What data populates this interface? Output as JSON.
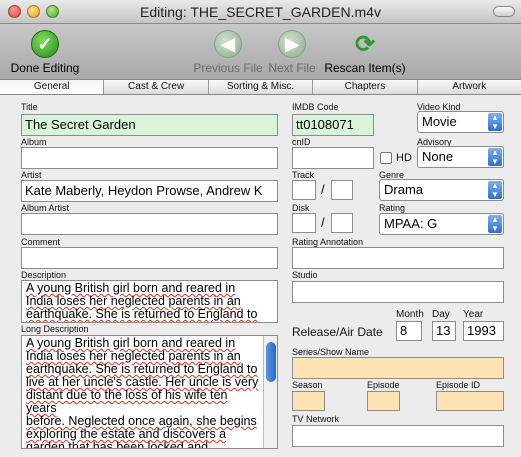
{
  "window": {
    "title": "Editing: THE_SECRET_GARDEN.m4v"
  },
  "toolbar": {
    "done_label": "Done Editing",
    "prev_label": "Previous File",
    "next_label": "Next File",
    "rescan_label": "Rescan Item(s)"
  },
  "tabs": [
    "General",
    "Cast & Crew",
    "Sorting & Misc.",
    "Chapters",
    "Artwork"
  ],
  "labels": {
    "title": "Title",
    "album": "Album",
    "artist": "Artist",
    "album_artist": "Album Artist",
    "comment": "Comment",
    "description": "Description",
    "long_description": "Long Description",
    "imdb": "IMDB Code",
    "cnid": "cnID",
    "track": "Track",
    "disk": "Disk",
    "rating_annotation": "Rating Annotation",
    "studio": "Studio",
    "video_kind": "Video Kind",
    "advisory": "Advisory",
    "hd": "HD",
    "genre": "Genre",
    "rating": "Rating",
    "month": "Month",
    "day": "Day",
    "year": "Year",
    "release_date": "Release/Air Date",
    "series": "Series/Show Name",
    "season": "Season",
    "episode": "Episode",
    "episode_id": "Episode ID",
    "tv_network": "TV Network"
  },
  "values": {
    "title": "The Secret Garden",
    "album": "",
    "artist": "Kate Maberly, Heydon Prowse, Andrew K",
    "album_artist": "",
    "comment": "",
    "imdb": "tt0108071",
    "cnid": "",
    "video_kind": "Movie",
    "advisory": "None",
    "genre": "Drama",
    "rating": "MPAA: G",
    "month": "8",
    "day": "13",
    "year": "1993",
    "description_lines": [
      "A young British girl born and reared in",
      "India loses her neglected parents in an",
      "earthquake. She is returned to England to"
    ],
    "long_description_lines": [
      "A young British girl born and reared in",
      "India loses her neglected parents in an",
      "earthquake. She is returned to England to",
      "live at her uncle's castle. Her uncle is very",
      "distant due to the loss of his wife ten years",
      "before. Neglected once again, she begins",
      "exploring the estate and discovers a",
      "garden that has been locked and"
    ]
  },
  "colors": {
    "done_green": "#3aa12a",
    "rescan_green": "#2e9a2e",
    "disabled_green": "#9ab89a",
    "peach": "#fde3b4",
    "mint": "#d9f4d9"
  },
  "icons": [
    "checkmark-icon",
    "left-arrow-icon",
    "right-arrow-icon",
    "refresh-arrows-icon"
  ]
}
